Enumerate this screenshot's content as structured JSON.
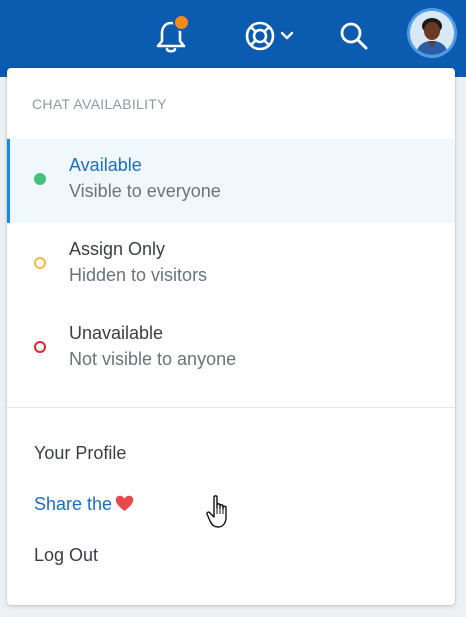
{
  "topbar": {
    "background_color": "#0b5bb0",
    "notification_dot_color": "#f58a1f",
    "icons": [
      "bell-icon",
      "help-lifebuoy-icon",
      "chevron-down-icon",
      "search-icon",
      "avatar"
    ]
  },
  "menu": {
    "section_caption": "CHAT AVAILABILITY",
    "statuses": [
      {
        "title": "Available",
        "subtitle": "Visible to everyone",
        "indicator": "filled-green-dot",
        "color": "#44c07a",
        "selected": true
      },
      {
        "title": "Assign Only",
        "subtitle": "Hidden to visitors",
        "indicator": "hollow-yellow-dot",
        "color": "#f6b73c",
        "selected": false
      },
      {
        "title": "Unavailable",
        "subtitle": "Not visible to anyone",
        "indicator": "hollow-red-dot",
        "color": "#d62b2b",
        "selected": false
      }
    ],
    "links": {
      "profile": "Your Profile",
      "share": "Share the",
      "share_icon": "heart-icon",
      "logout": "Log Out"
    },
    "accent_color": "#1b87e6",
    "link_blue": "#1a6fc4",
    "heart_color": "#e8474c"
  }
}
